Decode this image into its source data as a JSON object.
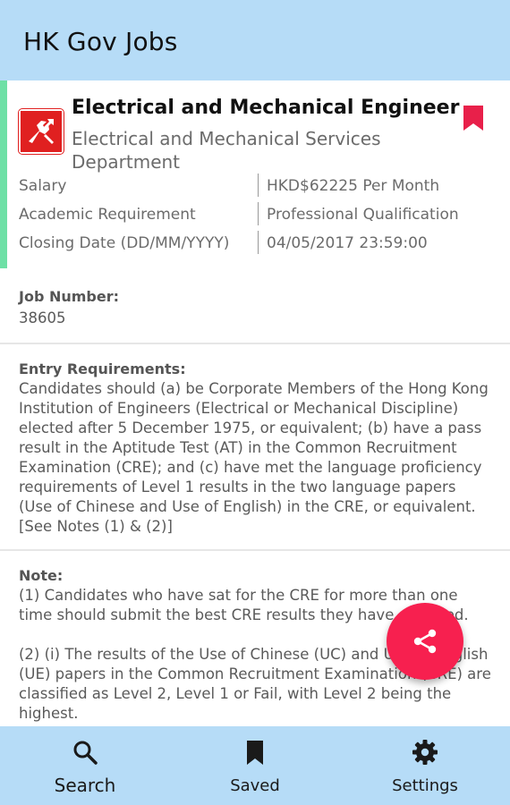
{
  "app": {
    "title": "HK Gov Jobs"
  },
  "job": {
    "title": "Electrical and Mechanical Engineer",
    "department": "Electrical and Mechanical Services Department",
    "info": [
      {
        "label": "Salary",
        "value": "HKD$62225 Per Month"
      },
      {
        "label": "Academic Requirement",
        "value": "Professional Qualification"
      },
      {
        "label": "Closing Date (DD/MM/YYYY)",
        "value": "04/05/2017 23:59:00"
      }
    ],
    "accent_color": "#6ee0a6",
    "bookmark_color": "#e8204a"
  },
  "job_number": {
    "title": "Job Number:",
    "value": "38605"
  },
  "entry_requirements": {
    "title": "Entry Requirements:",
    "text": "Candidates should (a) be Corporate Members of the Hong Kong Institution of Engineers (Electrical or Mechanical Discipline) elected after 5 December 1975, or equivalent; (b) have a pass result in the Aptitude Test (AT) in the Common Recruitment Examination (CRE); and (c) have met the language proficiency requirements of Level 1 results in the two language papers (Use of Chinese and Use of English) in the CRE, or equivalent. [See Notes (1) & (2)]"
  },
  "note": {
    "title": "Note:",
    "para1": "(1) Candidates who have sat for the CRE for more than one time should submit the best CRE results they have obtained.",
    "para2": "(2) (i) The results of the Use of Chinese (UC) and Use of English (UE) papers in the Common Recruitment Examination (CRE) are classified as Level 2, Level 1 or Fail, with Level 2 being the highest."
  },
  "fab": {
    "icon": "share-icon",
    "color": "#f7204f"
  },
  "bottom_nav": {
    "items": [
      {
        "label": "Search",
        "icon": "search-icon"
      },
      {
        "label": "Saved",
        "icon": "bookmark-icon"
      },
      {
        "label": "Settings",
        "icon": "gear-icon"
      }
    ],
    "active_index": 0,
    "color": "#b6dcf7"
  }
}
